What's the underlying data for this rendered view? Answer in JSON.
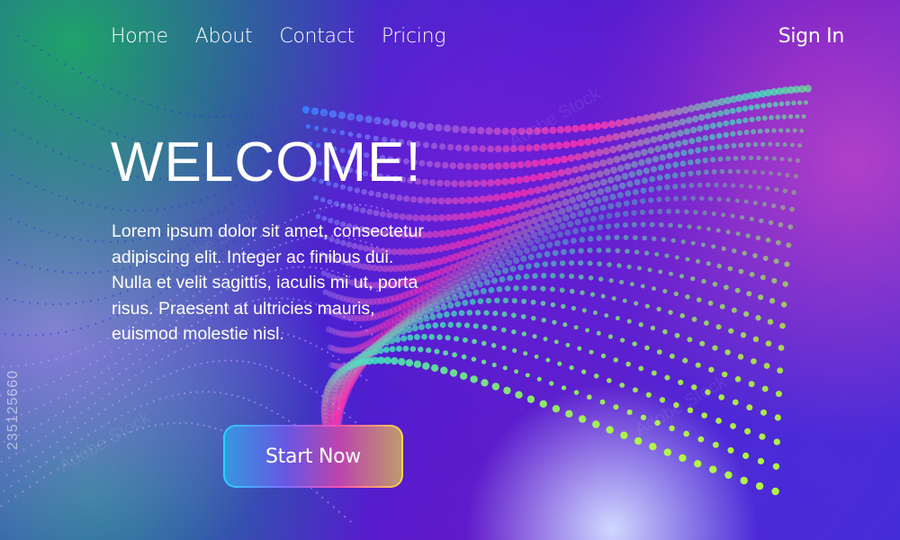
{
  "nav": {
    "items": [
      {
        "label": "Home"
      },
      {
        "label": "About"
      },
      {
        "label": "Contact"
      },
      {
        "label": "Pricing"
      }
    ],
    "sign_in": "Sign In"
  },
  "hero": {
    "title": "WELCOME!",
    "body": "Lorem ipsum dolor sit amet, consectetur adipiscing elit. Integer ac finibus dui. Nulla et velit sagittis, iaculis mi ut, porta risus. Praesent at ultricies mauris, euismod molestie nisl.",
    "cta_label": "Start Now"
  },
  "stock_id": "235125660",
  "watermark": "Adobe Stock",
  "colors": {
    "text": "#ffffff",
    "dots_start": "#3a7bff",
    "dots_mid": "#ff2fb0",
    "dots_end": "#b6ff3a"
  }
}
